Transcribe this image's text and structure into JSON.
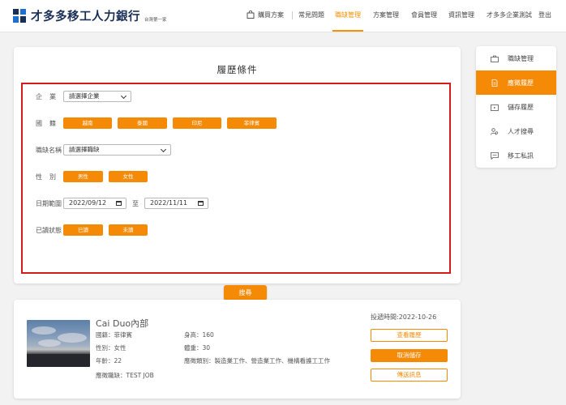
{
  "brand": {
    "name": "才多多移工人力銀行",
    "tagline": "台灣第一家",
    "colors": {
      "navy": "#1a2f55",
      "blue": "#1f6fd0",
      "accent": "#f58a07"
    }
  },
  "topnav": {
    "cart_label": "購買方案",
    "items": [
      "常見問題",
      "職缺管理",
      "方案管理",
      "會員管理",
      "資訊管理"
    ],
    "active_item": "職缺管理",
    "user_label": "才多多企業測試",
    "logout_label": "登出"
  },
  "criteria": {
    "title": "履歷條件",
    "company": {
      "label": "企業",
      "value": "請選擇企業"
    },
    "nationality": {
      "label": "國籍",
      "options": [
        "越南",
        "泰國",
        "印尼",
        "菲律賓"
      ]
    },
    "job": {
      "label": "職缺名稱",
      "value": "請選擇職缺"
    },
    "gender": {
      "label": "性別",
      "options": [
        "男性",
        "女性"
      ]
    },
    "date_range": {
      "label": "日期範圍",
      "from": "2022/09/12",
      "separator": "至",
      "to": "2022/11/11"
    },
    "read_status": {
      "label": "已讀狀態",
      "options": [
        "已讀",
        "未讀"
      ]
    },
    "search_label": "搜尋"
  },
  "sidebar": {
    "items": [
      {
        "label": "職缺管理",
        "icon": "briefcase-icon"
      },
      {
        "label": "應徵履歷",
        "icon": "document-icon"
      },
      {
        "label": "儲存履歷",
        "icon": "folder-icon"
      },
      {
        "label": "人才搜尋",
        "icon": "people-search-icon"
      },
      {
        "label": "移工私訊",
        "icon": "chat-icon"
      }
    ],
    "active_item": "應徵履歷"
  },
  "result": {
    "name": "Cai Duo內部",
    "posted": "投遞時間:2022-10-26",
    "nationality": "國籍：菲律賓",
    "gender": "性別：女性",
    "age": "年齡：22",
    "applied_job": "應徵職缺：TEST JOB",
    "height": "身高：160",
    "weight": "體重：30",
    "job_types": "應徵類別：製造業工作、營造業工作、機構看護工工作",
    "view_label": "查看履歷",
    "unsave_label": "取消儲存",
    "message_label": "傳送訊息"
  }
}
